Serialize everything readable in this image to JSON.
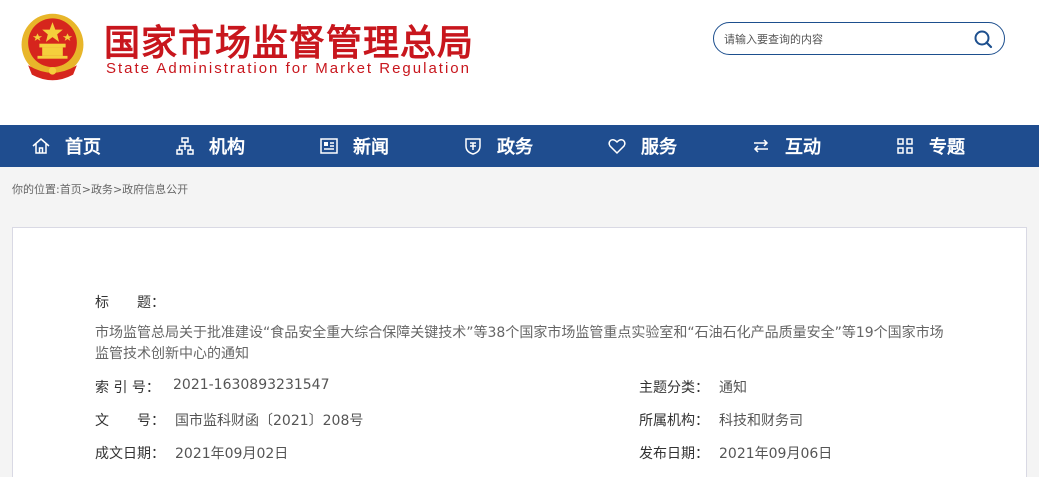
{
  "header": {
    "title_cn": "国家市场监督管理总局",
    "title_en": "State Administration for Market Regulation",
    "emblem_icon": "national-emblem-icon"
  },
  "search": {
    "placeholder": "请输入要查询的内容",
    "icon": "search-icon"
  },
  "nav": {
    "items": [
      {
        "label": "首页",
        "icon": "home-icon"
      },
      {
        "label": "机构",
        "icon": "org-chart-icon"
      },
      {
        "label": "新闻",
        "icon": "newspaper-icon"
      },
      {
        "label": "政务",
        "icon": "shield-icon"
      },
      {
        "label": "服务",
        "icon": "heart-icon"
      },
      {
        "label": "互动",
        "icon": "exchange-icon"
      },
      {
        "label": "专题",
        "icon": "grid-icon"
      }
    ]
  },
  "breadcrumb": {
    "prefix": "你的位置:",
    "items": [
      "首页",
      "政务",
      "政府信息公开"
    ],
    "separator": ">"
  },
  "doc": {
    "title_label": "标　　题：",
    "title_value": "市场监管总局关于批准建设“食品安全重大综合保障关键技术”等38个国家市场监管重点实验室和“石油石化产品质量安全”等19个国家市场监管技术创新中心的通知",
    "index_label": "索 引 号：",
    "index_value": "2021-1630893231547",
    "category_label": "主题分类：",
    "category_value": "通知",
    "docno_label": "文　　号：",
    "docno_value": "国市监科财函〔2021〕208号",
    "org_label": "所属机构：",
    "org_value": "科技和财务司",
    "created_label": "成文日期：",
    "created_value": "2021年09月02日",
    "published_label": "发布日期：",
    "published_value": "2021年09月06日"
  },
  "colors": {
    "brand_red": "#c8161d",
    "nav_blue": "#1f4d8f"
  }
}
